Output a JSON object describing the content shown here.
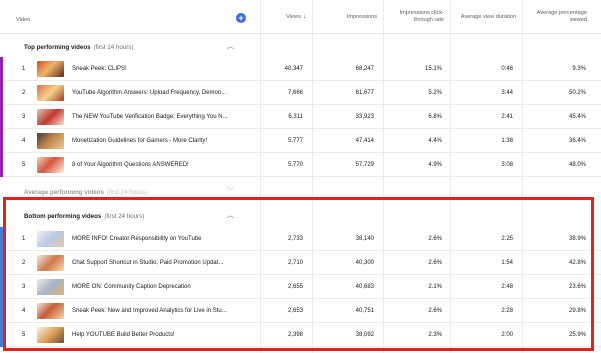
{
  "header": {
    "video_label": "Video",
    "views_label": "Views",
    "impressions_label": "Impressions",
    "ctr_label": "Impressions click-through rate",
    "avd_label": "Average view duration",
    "apv_label": "Average percentage viewed",
    "add_icon": "plus-circle-icon",
    "sort_icon": "arrow-down-icon"
  },
  "sections": {
    "top": {
      "title": "Top performing videos",
      "sub": "(first 24 hours)",
      "chevron": "chevron-up-icon",
      "accent": "#8e24aa"
    },
    "average": {
      "title": "Average performing videos",
      "sub": "(first 24 hours)",
      "chevron": "chevron-down-icon"
    },
    "bottom": {
      "title": "Bottom performing videos",
      "sub": "(first 24 hours)",
      "chevron": "chevron-up-icon",
      "accent": "#4a7bd0"
    }
  },
  "top_rows": [
    {
      "rank": "1",
      "title": "Sneak Peek: CLIPS!",
      "views": "40,347",
      "impressions": "68,247",
      "ctr": "15.1%",
      "avd": "0:46",
      "apv": "9.3%"
    },
    {
      "rank": "2",
      "title": "YouTube Algorithm Answers: Upload Frequency, Demon...",
      "views": "7,666",
      "impressions": "61,677",
      "ctr": "5.2%",
      "avd": "3:44",
      "apv": "50.2%"
    },
    {
      "rank": "3",
      "title": "The NEW YouTube Verification Badge: Everything You N...",
      "views": "6,311",
      "impressions": "33,923",
      "ctr": "6.8%",
      "avd": "2:41",
      "apv": "45.4%"
    },
    {
      "rank": "4",
      "title": "Monetization Guidelines for Gamers - More Clarity!",
      "views": "5,777",
      "impressions": "47,414",
      "ctr": "4.4%",
      "avd": "1:38",
      "apv": "36.4%"
    },
    {
      "rank": "5",
      "title": "8 of Your Algorithm Questions ANSWERED!",
      "views": "5,770",
      "impressions": "57,729",
      "ctr": "4.9%",
      "avd": "3:08",
      "apv": "48.0%"
    }
  ],
  "bottom_rows": [
    {
      "rank": "1",
      "title": "MORE INFO! Creator Responsibility on YouTube",
      "views": "2,733",
      "impressions": "38,140",
      "ctr": "2.6%",
      "avd": "2:25",
      "apv": "38.9%"
    },
    {
      "rank": "2",
      "title": "Chat Support Shortcut in Studio, Paid Promotion Updat...",
      "views": "2,710",
      "impressions": "40,300",
      "ctr": "2.6%",
      "avd": "1:54",
      "apv": "42.8%"
    },
    {
      "rank": "3",
      "title": "MORE ON: Community Caption Deprecation",
      "views": "2,655",
      "impressions": "40,683",
      "ctr": "2.1%",
      "avd": "2:48",
      "apv": "23.6%"
    },
    {
      "rank": "4",
      "title": "Sneak Peek: New and Improved Analytics for Live in Stu...",
      "views": "2,653",
      "impressions": "40,751",
      "ctr": "2.6%",
      "avd": "2:28",
      "apv": "29.8%"
    },
    {
      "rank": "5",
      "title": "Help YOUTUBE Build Better Products!",
      "views": "2,398",
      "impressions": "38,092",
      "ctr": "2.3%",
      "avd": "2:00",
      "apv": "25.9%"
    }
  ],
  "highlight_color": "#e0241b"
}
